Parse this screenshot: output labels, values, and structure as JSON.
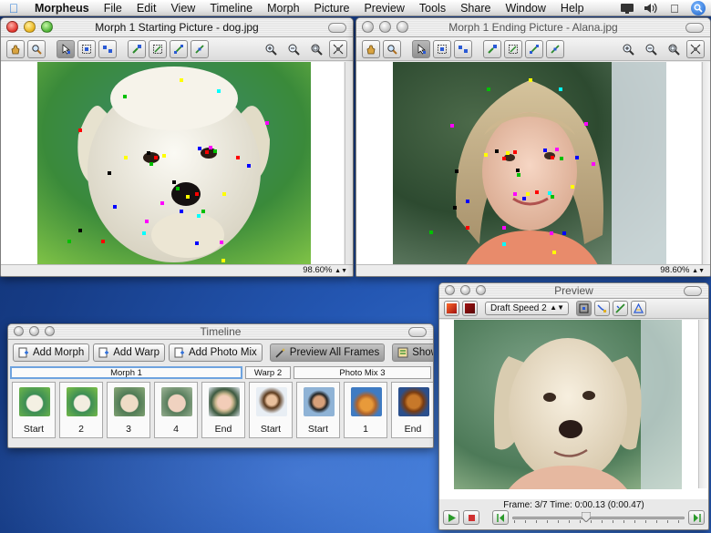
{
  "menubar": {
    "items": [
      "Morpheus",
      "File",
      "Edit",
      "View",
      "Timeline",
      "Morph",
      "Picture",
      "Preview",
      "Tools",
      "Share",
      "Window",
      "Help"
    ]
  },
  "start_window": {
    "title": "Morph 1 Starting Picture - dog.jpg",
    "zoom": "98.60%"
  },
  "end_window": {
    "title": "Morph 1 Ending Picture - Alana.jpg",
    "zoom": "98.60%"
  },
  "timeline": {
    "title": "Timeline",
    "buttons": {
      "add_morph": "Add Morph",
      "add_warp": "Add Warp",
      "add_photo_mix": "Add Photo Mix",
      "preview_all": "Preview All Frames",
      "show_key": "Show Key Frames"
    },
    "groups": {
      "morph": "Morph 1",
      "warp": "Warp 2",
      "photomix": "Photo Mix 3"
    },
    "frames": [
      "Start",
      "2",
      "3",
      "4",
      "End",
      "Start",
      "Start",
      "1",
      "End"
    ]
  },
  "preview": {
    "title": "Preview",
    "speed": "Draft Speed 2",
    "frame_info": "Frame: 3/7  Time: 0:00.13 (0:00.47)",
    "slider_position": 0.43
  },
  "colors": {
    "accent": "#2a7bd5",
    "markers": [
      "#ff0000",
      "#00c000",
      "#0000ff",
      "#ff00ff",
      "#ffff00",
      "#00ffff",
      "#000000"
    ]
  }
}
